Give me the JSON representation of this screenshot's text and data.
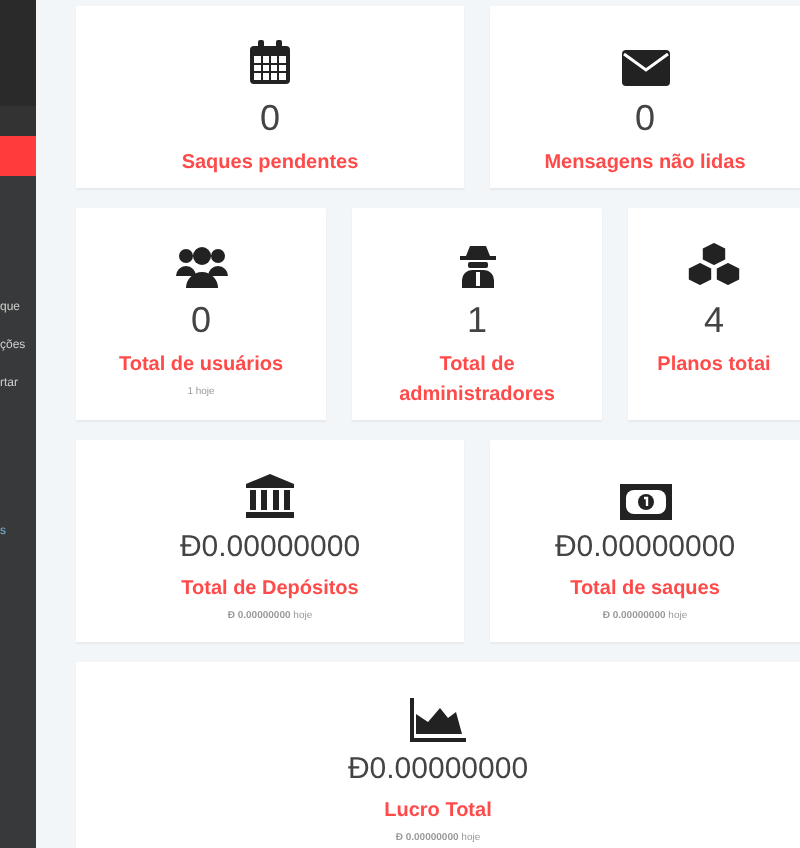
{
  "sidebar": {
    "items": [
      {
        "label": "que",
        "selected": false
      },
      {
        "label": "ções",
        "selected": false
      },
      {
        "label": "rtar",
        "selected": false
      },
      {
        "label": "s",
        "selected": false,
        "kind": "link"
      }
    ]
  },
  "rows": [
    {
      "cards": [
        {
          "kind": "calendar",
          "value": "0",
          "label": "Saques pendentes"
        },
        {
          "kind": "envelope",
          "value": "0",
          "label": "Mensagens não lidas"
        }
      ]
    },
    {
      "cards": [
        {
          "kind": "users",
          "value": "0",
          "label": "Total de usuários",
          "sub": "1 hoje"
        },
        {
          "kind": "spy",
          "value": "1",
          "label": "Total de administradores"
        },
        {
          "kind": "cubes",
          "value": "4",
          "label": "Planos totai"
        }
      ]
    },
    {
      "cards": [
        {
          "kind": "bank",
          "value": "Đ0.00000000",
          "label": "Total de Depósitos",
          "sub": "**Đ 0.00000000** hoje"
        },
        {
          "kind": "money",
          "value": "Đ0.00000000",
          "label": "Total de saques",
          "sub": "**Đ 0.00000000** hoje"
        }
      ]
    },
    {
      "cards": [
        {
          "kind": "chart",
          "value": "Đ0.00000000",
          "label": "Lucro Total",
          "sub": "**Đ 0.00000000** hoje"
        }
      ]
    }
  ]
}
